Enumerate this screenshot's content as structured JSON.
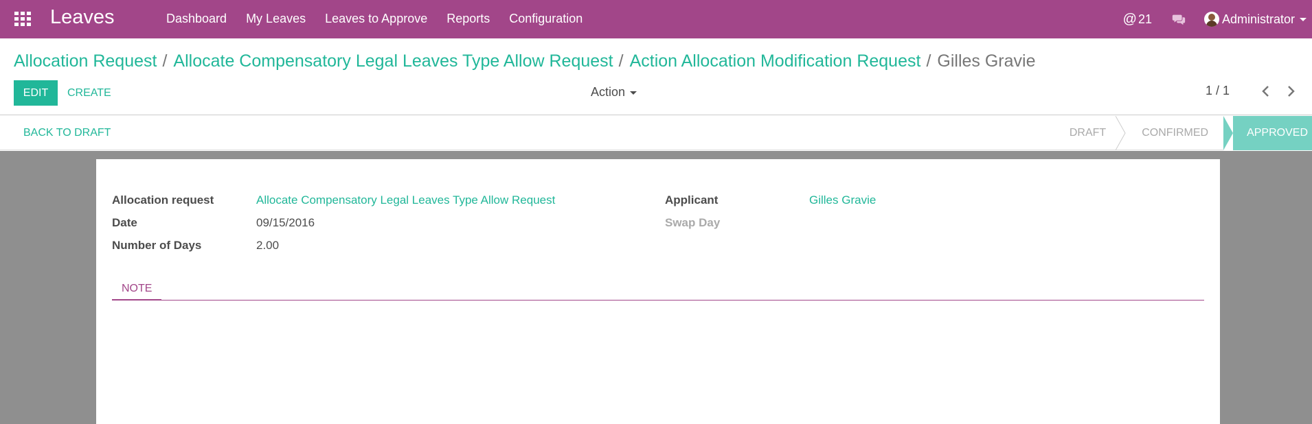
{
  "app": {
    "title": "Leaves",
    "brand_color": "#a24689",
    "accent_color": "#21b799"
  },
  "nav": {
    "menu": [
      "Dashboard",
      "My Leaves",
      "Leaves to Approve",
      "Reports",
      "Configuration"
    ],
    "mentions": "21",
    "user_name": "Administrator"
  },
  "breadcrumb": {
    "items": [
      "Allocation Request",
      "Allocate Compensatory Legal Leaves Type Allow Request",
      "Action Allocation Modification Request"
    ],
    "separator": "/",
    "current": "Gilles Gravie"
  },
  "toolbar": {
    "edit_label": "EDIT",
    "create_label": "CREATE",
    "action_label": "Action",
    "pager_value": "1 / 1"
  },
  "statusbar": {
    "back_to_draft_label": "BACK TO DRAFT",
    "stages": [
      "DRAFT",
      "CONFIRMED",
      "APPROVED"
    ],
    "active_stage": "APPROVED"
  },
  "form": {
    "allocation_request_label": "Allocation request",
    "allocation_request_value": "Allocate Compensatory Legal Leaves Type Allow Request",
    "date_label": "Date",
    "date_value": "09/15/2016",
    "days_label": "Number of Days",
    "days_value": "2.00",
    "applicant_label": "Applicant",
    "applicant_value": "Gilles Gravie",
    "swap_day_label": "Swap Day",
    "tabs": [
      "NOTE"
    ]
  },
  "icons": [
    "apps-grid-icon",
    "at-icon",
    "chat-icon",
    "user-avatar",
    "chevron-left-icon",
    "chevron-right-icon",
    "caret-down-icon"
  ]
}
